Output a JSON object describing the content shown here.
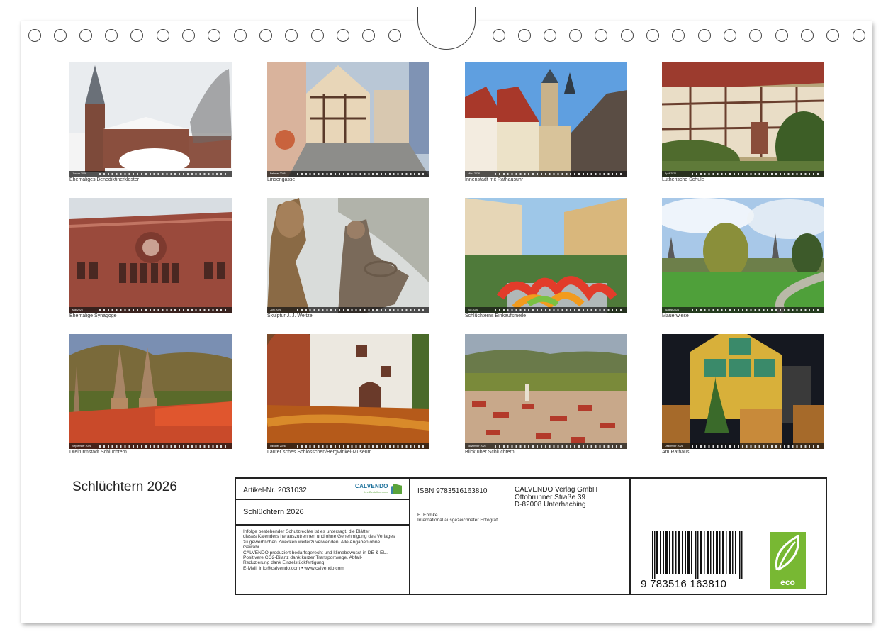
{
  "calendar": {
    "title": "Schlüchtern 2026"
  },
  "months": [
    {
      "strip": "Januar 2026",
      "caption": "Ehemaliges Benediktinerkloster"
    },
    {
      "strip": "Februar 2026",
      "caption": "Linsengasse"
    },
    {
      "strip": "März 2026",
      "caption": "Innenstadt mit Rathausuhr"
    },
    {
      "strip": "April 2026",
      "caption": "Lutherische Schule"
    },
    {
      "strip": "Mai 2026",
      "caption": "Ehemalige Synagoge"
    },
    {
      "strip": "Juni 2026",
      "caption": "Skulptur J. J. Weitzel"
    },
    {
      "strip": "Juli 2026",
      "caption": "Schlüchterns Einkaufsmeile"
    },
    {
      "strip": "August 2026",
      "caption": "Mauerwiese"
    },
    {
      "strip": "September 2026",
      "caption": "Dreiturmstadt Schlüchtern"
    },
    {
      "strip": "Oktober 2026",
      "caption": "Lauter´sches Schlösschen/Bergwinkel-Museum"
    },
    {
      "strip": "November 2026",
      "caption": "Blick über Schlüchtern"
    },
    {
      "strip": "Dezember 2026",
      "caption": "Am Rathaus"
    }
  ],
  "info": {
    "article": "Artikel-Nr. 2031032",
    "logo_name": "CALVENDO",
    "logo_sub": "Ihre Bestellnummer",
    "title": "Schlüchtern 2026",
    "legal": [
      "Infolge bestehender Schutzrechte ist es untersagt, die Blätter",
      "dieses Kalenders herauszutrennen und ohne Genehmigung des Verlages",
      "zu gewerblichen Zwecken weiterzuverwenden. Alle Angaben ohne",
      "Gewähr.",
      "CALVENDO produziert bedarfsgerecht und klimabewusst in DE & EU.",
      "Positivere CO2-Bilanz dank kurzer Transportwege. Abfall-",
      "Reduzierung dank Einzelstückfertigung.",
      "E-Mail: info@calvendo.com • www.calvendo.com"
    ],
    "isbn": "ISBN 9783516163810",
    "author_name": "E. Ehmke",
    "author_desc": "International ausgezeichneter Fotograf",
    "publisher": [
      "CALVENDO Verlag GmbH",
      "Ottobrunner Straße 39",
      "D-82008 Unterhaching"
    ],
    "barcode_digits": "9 783516 163810",
    "eco_label": "eco"
  }
}
